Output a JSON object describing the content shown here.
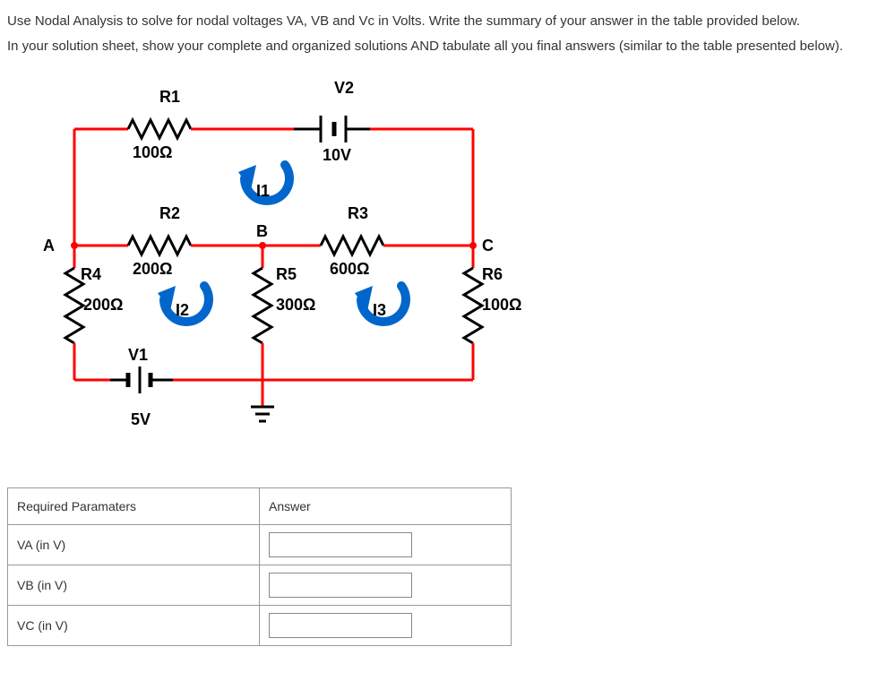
{
  "instructions": {
    "line1": "Use Nodal Analysis to solve for nodal voltages VA, VB and Vc in Volts. Write the summary of your answer in the table provided below.",
    "line2": "In your solution sheet, show your complete and organized solutions AND tabulate all you final answers (similar to the table presented below)."
  },
  "circuit": {
    "nodes": {
      "A": "A",
      "B": "B",
      "C": "C"
    },
    "components": {
      "R1": {
        "name": "R1",
        "value": "100Ω"
      },
      "R2": {
        "name": "R2",
        "value": "200Ω"
      },
      "R3": {
        "name": "R3",
        "value": "600Ω"
      },
      "R4": {
        "name": "R4",
        "value": "200Ω"
      },
      "R5": {
        "name": "R5",
        "value": "300Ω"
      },
      "R6": {
        "name": "R6",
        "value": "100Ω"
      },
      "V1": {
        "name": "V1",
        "value": "5V"
      },
      "V2": {
        "name": "V2",
        "value": "10V"
      },
      "I1": "I1",
      "I2": "I2",
      "I3": "I3"
    }
  },
  "table": {
    "header_left": "Required Paramaters",
    "header_right": "Answer",
    "rows": [
      {
        "label": "VA (in V)",
        "value": ""
      },
      {
        "label": "VB (in V)",
        "value": ""
      },
      {
        "label": "VC (in V)",
        "value": ""
      }
    ]
  }
}
